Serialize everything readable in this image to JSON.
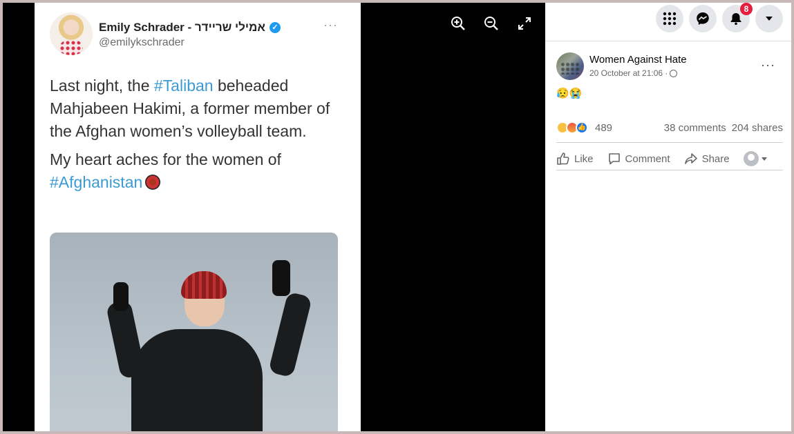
{
  "viewer": {
    "tweet": {
      "author_name": "Emily Schrader - אמילי שריידר",
      "author_handle": "@emilykschrader",
      "more": "···",
      "text_line1_pre": "Last night, the ",
      "text_line1_hash": "#Taliban",
      "text_line1_post": " beheaded Mahjabeen Hakimi, a former member of the Afghan women’s volleyball team.",
      "text_line2": "My heart aches for the women of",
      "text_line2_hash": "#Afghanistan"
    },
    "controls": [
      "zoom-in-icon",
      "zoom-out-icon",
      "fullscreen-icon"
    ]
  },
  "topbar": {
    "notifications_badge": "8"
  },
  "post": {
    "page_name": "Women Against Hate",
    "date": "20 October at 21:06 ·",
    "more": "···",
    "text": "😥😭",
    "reaction_count": "489",
    "comments": "38 comments",
    "shares": "204 shares",
    "actions": {
      "like": "Like",
      "comment": "Comment",
      "share": "Share"
    }
  }
}
